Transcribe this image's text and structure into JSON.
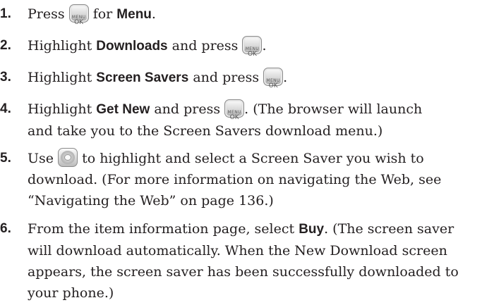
{
  "menu_key": {
    "line1": "MENU",
    "line2": "OK"
  },
  "steps": [
    {
      "num": "1.",
      "a": "Press ",
      "b": " for ",
      "kw": "Menu",
      "c": "."
    },
    {
      "num": "2.",
      "a": "Highlight ",
      "kw": "Downloads",
      "b": " and press ",
      "c": "."
    },
    {
      "num": "3.",
      "a": "Highlight ",
      "kw": "Screen Savers",
      "b": " and press ",
      "c": "."
    },
    {
      "num": "4.",
      "a": "Highlight ",
      "kw": "Get New",
      "b": " and press ",
      "c": ". (The browser will launch",
      "d": "and take you to the Screen Savers download menu.)"
    },
    {
      "num": "5.",
      "a": "Use ",
      "b": " to highlight and select a Screen Saver you wish to",
      "c": "download. (For more information on navigating the Web, see",
      "d": "“Navigating the Web” on page 136.)"
    },
    {
      "num": "6.",
      "a": "From the item information page, select ",
      "kw": "Buy",
      "b": ". (The screen saver",
      "c": "will download automatically. When the New Download screen",
      "d": "appears, the screen saver has been successfully downloaded to",
      "e": "your phone.)"
    }
  ]
}
